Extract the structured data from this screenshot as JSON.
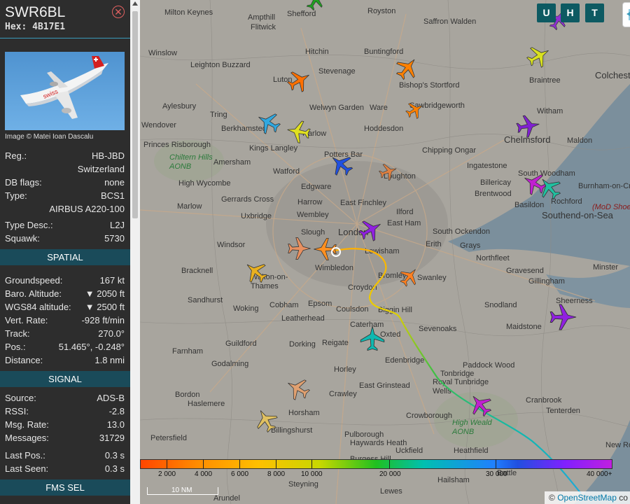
{
  "aircraft": {
    "callsign": "SWR6BL",
    "hex": "Hex: 4B17E1",
    "close_icon": "close-circle-icon",
    "image_credit": "Image © Matei Ioan Dascalu",
    "details": [
      {
        "label": "Reg.:",
        "value": "HB-JBD"
      },
      {
        "label": "",
        "value": "Switzerland"
      },
      {
        "label": "DB flags:",
        "value": "none"
      },
      {
        "label": "Type:",
        "value": "BCS1"
      },
      {
        "label": "",
        "value": "AIRBUS A220-100"
      },
      {
        "label": "Type Desc.:",
        "value": "L2J"
      },
      {
        "label": "Squawk:",
        "value": "5730"
      }
    ]
  },
  "sections": {
    "spatial": "SPATIAL",
    "signal": "SIGNAL",
    "fms": "FMS SEL"
  },
  "spatial": [
    {
      "label": "Groundspeed:",
      "value": "167 kt"
    },
    {
      "label": "Baro. Altitude:",
      "value": "▼ 2050 ft"
    },
    {
      "label": "WGS84 altitude:",
      "value": "▼ 2500 ft"
    },
    {
      "label": "Vert. Rate:",
      "value": "-928 ft/min"
    },
    {
      "label": "Track:",
      "value": "270.0°"
    },
    {
      "label": "Pos.:",
      "value": "51.465°, -0.248°"
    },
    {
      "label": "Distance:",
      "value": "1.8 nmi"
    }
  ],
  "signal": [
    {
      "label": "Source:",
      "value": "ADS-B"
    },
    {
      "label": "RSSI:",
      "value": "-2.8"
    },
    {
      "label": "Msg. Rate:",
      "value": "13.0"
    },
    {
      "label": "Messages:",
      "value": "31729"
    },
    {
      "label": "Last Pos.:",
      "value": "0.3 s"
    },
    {
      "label": "Last Seen:",
      "value": "0.3 s"
    }
  ],
  "map_buttons": {
    "u": "U",
    "h": "H",
    "t": "T"
  },
  "colorbar_labels": [
    "2 000",
    "4 000",
    "6 000",
    "8 000",
    "10 000",
    "20 000",
    "30 000",
    "40 000+"
  ],
  "scale": "10 NM",
  "attribution": {
    "symbol": "©",
    "link": "OpenStreetMap",
    "suffix": " co"
  },
  "places": [
    "Milton Keynes",
    "Shefford",
    "Royston",
    "Ampthill",
    "Flitwick",
    "Saffron Walden",
    "Winslow",
    "Luton",
    "Hitchin",
    "Buntingford",
    "Stevenage",
    "Leighton Buzzard",
    "Bishop's Stortford",
    "Braintree",
    "Colchester",
    "Aylesbury",
    "Tring",
    "Welwyn Garden",
    "Ware",
    "Sawbridgeworth",
    "Witham",
    "Wendover",
    "Berkhamsted",
    "Hoddesdon",
    "Harlow",
    "Chelmsford",
    "Maldon",
    "Princes Risborough",
    "Kings Langley",
    "Chipping Ongar",
    "Chiltern Hills AONB",
    "Amersham",
    "Watford",
    "Potters Bar",
    "Loughton",
    "Ingatestone",
    "High Wycombe",
    "Edgware",
    "Billericay",
    "South Woodham",
    "Burnham-on-Crouch",
    "Marlow",
    "Gerrards Cross",
    "Harrow",
    "Brentwood",
    "Basildon",
    "Rochford",
    "Wembley",
    "East Finchley",
    "Uxbridge",
    "London",
    "Ilford",
    "East Ham",
    "South Ockendon",
    "Southend-on-Sea",
    "(MoD Shoeb",
    "Windsor",
    "Slough",
    "Lewisham",
    "Erith",
    "Grays",
    "Bracknell",
    "Wimbledon",
    "Northfleet",
    "Gravesend",
    "Walton-on-Thames",
    "Croydon",
    "Bromley",
    "Swanley",
    "Minster",
    "Gillingham",
    "Sandhurst",
    "Woking",
    "Cobham",
    "Epsom",
    "Coulsdon",
    "Biggin Hill",
    "Snodland",
    "Sheerness",
    "Leatherhead",
    "Caterham",
    "Sevenoaks",
    "Maidstone",
    "Farnham",
    "Guildford",
    "Dorking",
    "Reigate",
    "Oxted",
    "Edenbridge",
    "Godalming",
    "Horley",
    "Paddock Wood",
    "Tonbridge",
    "Royal Tunbridge Wells",
    "East Grinstead",
    "Crawley",
    "Bordon",
    "Haslemere",
    "Crowborough",
    "Cranbrook",
    "Horsham",
    "High Weald AONB",
    "Tenterden",
    "Petersfield",
    "Billingshurst",
    "Haywards Heath",
    "Pulborough",
    "Uckfield",
    "Heathfield",
    "New Romney",
    "Burgess Hill",
    "Hailsham",
    "Steyning",
    "Lewes",
    "Arundel",
    "Battle"
  ]
}
